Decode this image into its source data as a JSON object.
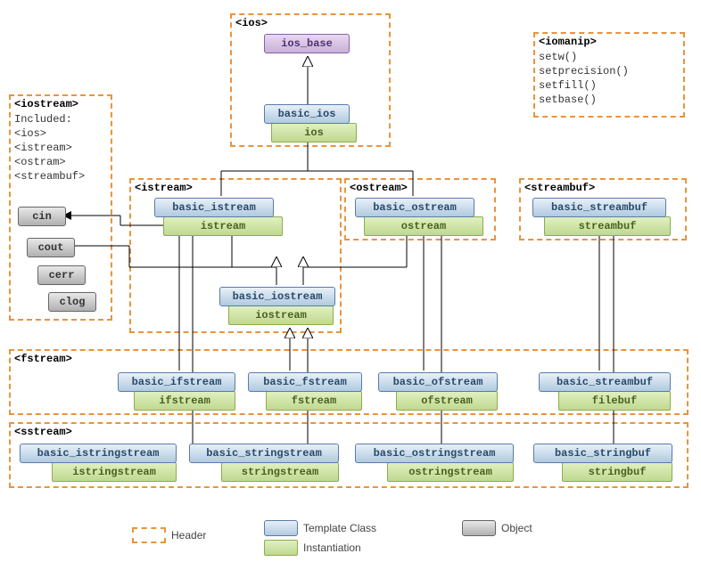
{
  "headers": {
    "ios": "<ios>",
    "iomanip": "<iomanip>",
    "iomanip_lines": "setw()\nsetprecision()\nsetfill()\nsetbase()",
    "iostream": "<iostream>",
    "iostream_lines": "Included:\n<ios>\n<istream>\n<ostram>\n<streambuf>",
    "istream": "<istream>",
    "ostream": "<ostream>",
    "streambuf": "<streambuf>",
    "fstream": "<fstream>",
    "sstream": "<sstream>"
  },
  "classes": {
    "ios_base": "ios_base",
    "basic_ios": "basic_ios",
    "ios": "ios",
    "basic_istream": "basic_istream",
    "istream": "istream",
    "basic_ostream": "basic_ostream",
    "ostream": "ostream",
    "basic_streambuf": "basic_streambuf",
    "streambuf": "streambuf",
    "basic_iostream": "basic_iostream",
    "iostream": "iostream",
    "basic_ifstream": "basic_ifstream",
    "ifstream": "ifstream",
    "basic_fstream": "basic_fstream",
    "fstream_c": "fstream",
    "basic_ofstream": "basic_ofstream",
    "ofstream": "ofstream",
    "basic_filebuf": "basic_streambuf",
    "filebuf": "filebuf",
    "basic_istringstream": "basic_istringstream",
    "istringstream": "istringstream",
    "basic_stringstream": "basic_stringstream",
    "stringstream": "stringstream",
    "basic_ostringstream": "basic_ostringstream",
    "ostringstream": "ostringstream",
    "basic_stringbuf": "basic_stringbuf",
    "stringbuf": "stringbuf"
  },
  "objects": {
    "cin": "cin",
    "cout": "cout",
    "cerr": "cerr",
    "clog": "clog"
  },
  "legend": {
    "header": "Header",
    "tclass": "Template Class",
    "inst": "Instantiation",
    "object": "Object"
  },
  "chart_data": {
    "type": "diagram",
    "title": "C++ IO Streams class hierarchy",
    "headers": [
      {
        "name": "<ios>",
        "contains": [
          "ios_base",
          "basic_ios/ios"
        ]
      },
      {
        "name": "<iomanip>",
        "functions": [
          "setw()",
          "setprecision()",
          "setfill()",
          "setbase()"
        ]
      },
      {
        "name": "<iostream>",
        "includes": [
          "<ios>",
          "<istream>",
          "<ostram>",
          "<streambuf>"
        ],
        "objects": [
          "cin",
          "cout",
          "cerr",
          "clog"
        ]
      },
      {
        "name": "<istream>",
        "contains": [
          "basic_istream/istream",
          "basic_iostream/iostream"
        ]
      },
      {
        "name": "<ostream>",
        "contains": [
          "basic_ostream/ostream"
        ]
      },
      {
        "name": "<streambuf>",
        "contains": [
          "basic_streambuf/streambuf"
        ]
      },
      {
        "name": "<fstream>",
        "contains": [
          "basic_ifstream/ifstream",
          "basic_fstream/fstream",
          "basic_ofstream/ofstream",
          "basic_streambuf/filebuf"
        ]
      },
      {
        "name": "<sstream>",
        "contains": [
          "basic_istringstream/istringstream",
          "basic_stringstream/stringstream",
          "basic_ostringstream/ostringstream",
          "basic_stringbuf/stringbuf"
        ]
      }
    ],
    "inheritance_edges": [
      [
        "basic_ios",
        "ios_base"
      ],
      [
        "basic_istream",
        "basic_ios"
      ],
      [
        "basic_ostream",
        "basic_ios"
      ],
      [
        "basic_iostream",
        "basic_istream"
      ],
      [
        "basic_iostream",
        "basic_ostream"
      ],
      [
        "basic_ifstream",
        "basic_istream"
      ],
      [
        "basic_fstream",
        "basic_iostream"
      ],
      [
        "basic_ofstream",
        "basic_ostream"
      ],
      [
        "basic_filebuf(filebuf)",
        "basic_streambuf"
      ],
      [
        "basic_istringstream",
        "basic_istream"
      ],
      [
        "basic_stringstream",
        "basic_iostream"
      ],
      [
        "basic_ostringstream",
        "basic_ostream"
      ],
      [
        "basic_stringbuf",
        "basic_streambuf"
      ]
    ],
    "object_arrows": [
      [
        "cin",
        "istream"
      ],
      [
        "cout",
        "ostream"
      ]
    ],
    "legend": [
      "Header",
      "Template Class",
      "Instantiation",
      "Object"
    ]
  }
}
